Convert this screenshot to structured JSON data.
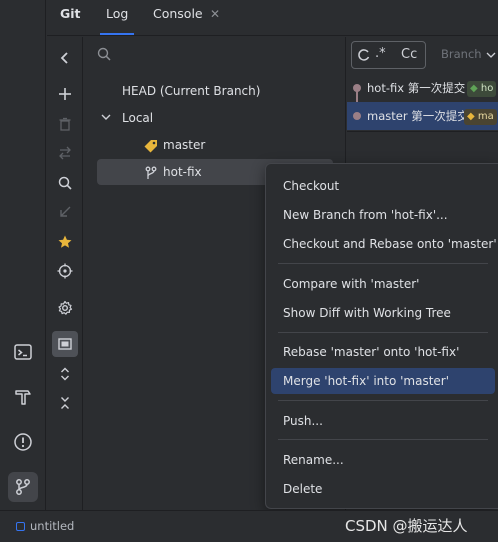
{
  "colors": {
    "background": "#2b2d30",
    "accent": "#3574f0",
    "menu_highlight": "#2e436e",
    "tag_yellow": "#e8b63c",
    "tag_green": "#5fa456",
    "graph_line": "#9b7f86"
  },
  "tabs": {
    "git": "Git",
    "log": "Log",
    "console": "Console",
    "close_glyph": "✕"
  },
  "left_bar": {
    "icons": [
      "terminal-icon",
      "build-hammer-icon",
      "problems-icon",
      "git-branch-icon"
    ]
  },
  "toolbar": {
    "icons": [
      "chevron-left-icon",
      "plus-icon",
      "trash-icon",
      "update-icon",
      "search-icon",
      "merge-icon",
      "star-icon",
      "target-icon",
      "gear-icon",
      "group-icon",
      "expand-icon",
      "collapse-icon"
    ]
  },
  "branches": {
    "head": "HEAD (Current Branch)",
    "local_group": "Local",
    "items": [
      {
        "label": "master",
        "icon": "tag-icon"
      },
      {
        "label": "hot-fix",
        "icon": "branch-icon"
      }
    ]
  },
  "log": {
    "filter_regex": ".*",
    "filter_case": "Cc",
    "branch_filter": "Branch",
    "commits": [
      {
        "message": "hot-fix 第一次提交",
        "tag": "ho"
      },
      {
        "message": "master 第一次提交",
        "tag": "ma"
      }
    ]
  },
  "context_menu": {
    "items": [
      "Checkout",
      "New Branch from 'hot-fix'...",
      "Checkout and Rebase onto 'master'",
      "Compare with 'master'",
      "Show Diff with Working Tree",
      "Rebase 'master' onto 'hot-fix'",
      "Merge 'hot-fix' into 'master'",
      "Push...",
      "Rename...",
      "Delete"
    ],
    "highlighted_index": 6
  },
  "status": {
    "project": "untitled",
    "watermark": "CSDN @搬运达人"
  }
}
